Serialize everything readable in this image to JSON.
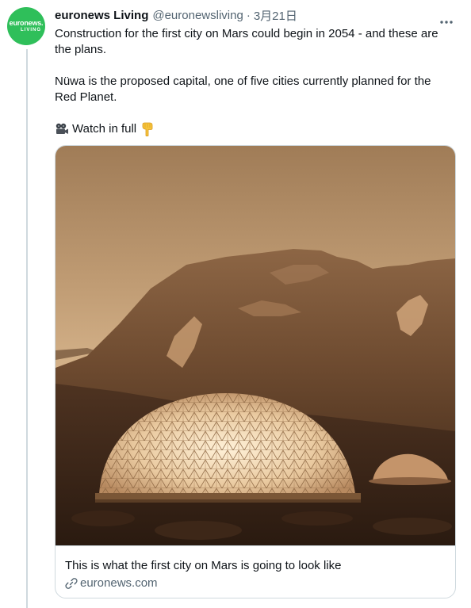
{
  "tweet": {
    "author": {
      "display_name": "euronews Living",
      "handle": "@euronewsliving",
      "avatar": {
        "logo_top": "euronews.",
        "logo_bottom": "LIVING",
        "background": "#2fbf5a"
      }
    },
    "separator": "·",
    "timestamp": "3月21日",
    "text": {
      "paragraph1": "Construction for the first city on Mars could begin in 2054 - and these are the plans.",
      "paragraph2": "Nüwa is the proposed capital, one of five cities currently planned for the Red Planet.",
      "watch": "Watch in full"
    },
    "icons": {
      "more": "more-options-icon",
      "camera": "film-projector-icon",
      "pointing": "pointing-down-icon",
      "link": "link-icon"
    },
    "card": {
      "title": "This is what the first city on Mars is going to look like",
      "domain": "euronews.com"
    }
  },
  "colors": {
    "text_primary": "#0f1419",
    "text_secondary": "#536471",
    "border": "#cfd9de",
    "thread_line": "#cfd9de"
  }
}
